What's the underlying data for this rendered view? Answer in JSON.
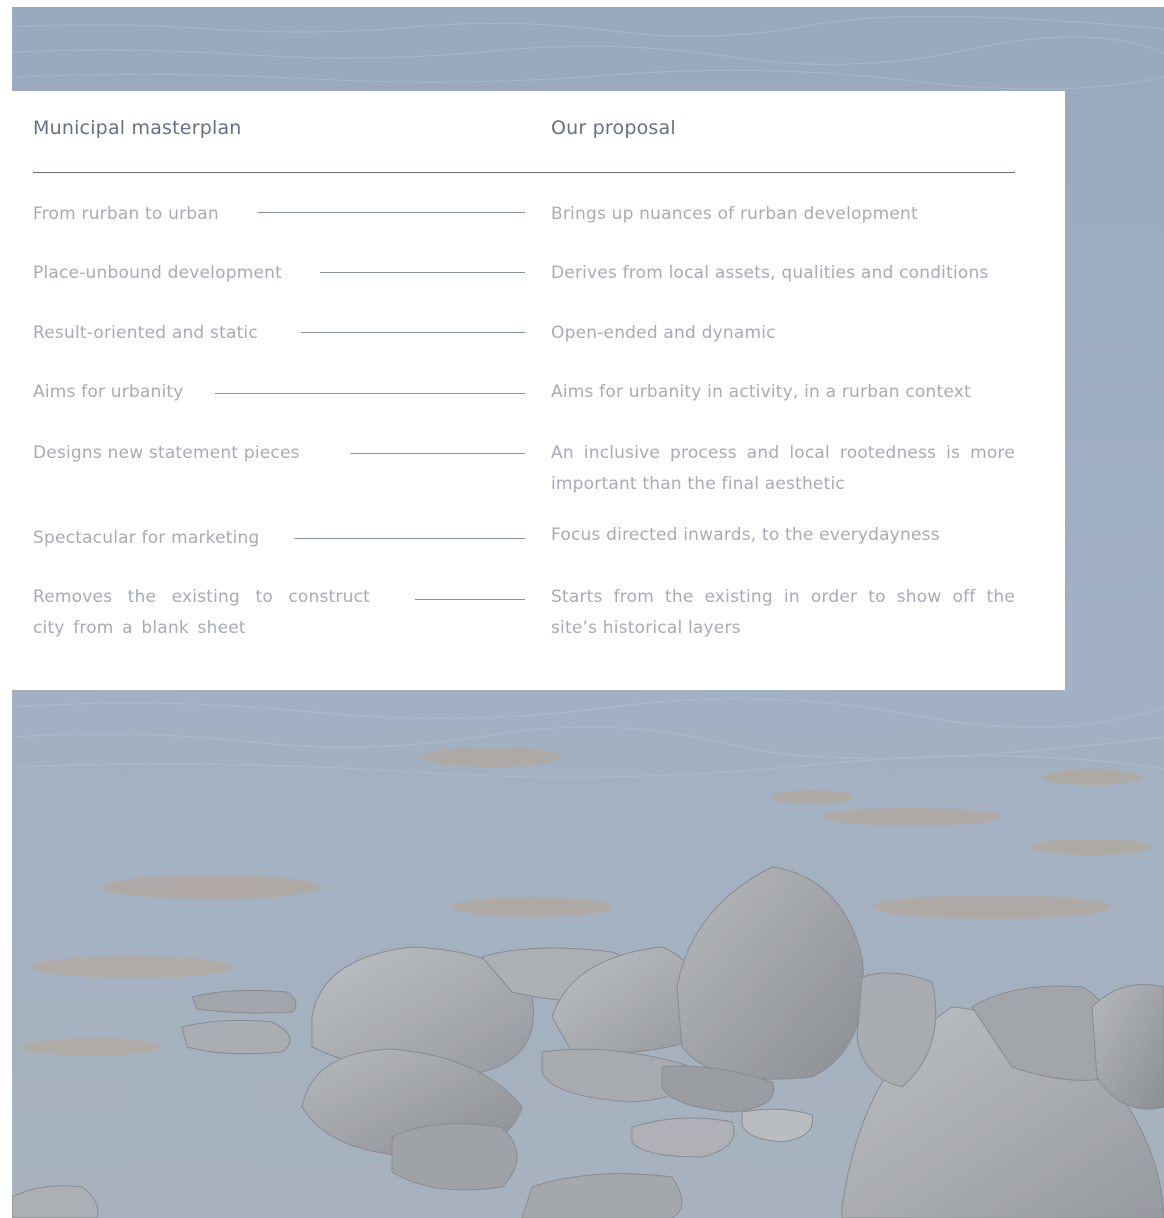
{
  "table": {
    "header_left": "Municipal masterplan",
    "header_right": "Our proposal",
    "rows": [
      {
        "left": "From rurban to urban",
        "right": "Brings up nuances of rurban development"
      },
      {
        "left": "Place-unbound development",
        "right": "Derives from local assets, qualities and conditions"
      },
      {
        "left": "Result-oriented and static",
        "right": "Open-ended and dynamic"
      },
      {
        "left": "Aims for urbanity",
        "right": "Aims for urbanity in activity, in a rurban context"
      },
      {
        "left": "Designs new statement pieces",
        "right": "An inclusive process and local rootedness is more important than the final aesthetic"
      },
      {
        "left": "Spectacular for marketing",
        "right": "Focus directed inwards, to the everydayness"
      },
      {
        "left": "Removes the existing to construct city from a blank sheet",
        "right": "Starts from the existing in order to show off the site’s historical layers"
      }
    ]
  },
  "colors": {
    "header_text": "#6b6f80",
    "body_text": "#a9abb4",
    "rule": "#6a6e8a",
    "water": "#7b91ae",
    "rock": "#8d9298"
  }
}
